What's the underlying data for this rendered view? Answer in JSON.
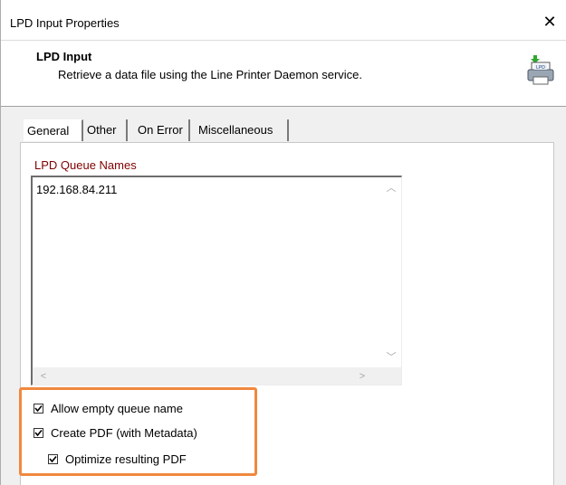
{
  "window": {
    "title": "LPD Input Properties"
  },
  "header": {
    "title": "LPD Input",
    "description": "Retrieve a data file using the Line Printer Daemon service.",
    "icon_label": "LPD"
  },
  "tabs": [
    {
      "label": "General",
      "active": true
    },
    {
      "label": "Other",
      "active": false
    },
    {
      "label": "On Error",
      "active": false
    },
    {
      "label": "Miscellaneous",
      "active": false
    }
  ],
  "queue": {
    "label": "LPD Queue Names",
    "value": "192.168.84.211"
  },
  "options": [
    {
      "label": "Allow empty queue name",
      "checked": true
    },
    {
      "label": "Create PDF (with Metadata)",
      "checked": true
    },
    {
      "label": "Optimize resulting PDF",
      "checked": true
    }
  ],
  "colors": {
    "highlight": "#f0883e",
    "queue_label": "#800000"
  }
}
